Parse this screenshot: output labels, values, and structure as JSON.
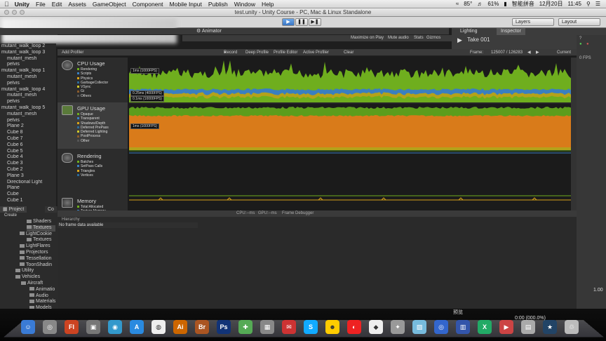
{
  "menubar": {
    "apple": "",
    "items": [
      "Unity",
      "File",
      "Edit",
      "Assets",
      "GameObject",
      "Component",
      "Mobile Input",
      "Publish",
      "Window",
      "Help"
    ],
    "battery": "61%",
    "temp": "85°",
    "ime": "智能拼音",
    "date": "12月20日",
    "time": "11:45"
  },
  "window": {
    "title": "test.unity - Unity Course - PC, Mac & Linux Standalone"
  },
  "toolbar": {
    "layers": "Layers",
    "layout": "Layout"
  },
  "tabs": {
    "animator": "Animator",
    "lighting": "Lighting",
    "inspector": "Inspector"
  },
  "inspector": {
    "take": "Take 001"
  },
  "game_toolbar": {
    "maximize": "Maximize on Play",
    "mute": "Mute audio",
    "stats": "Stats",
    "gizmos": "Gizmos"
  },
  "hierarchy_items": [
    "mutant_walk_loop 2",
    "mutant_walk_loop 3",
    "mutant_mesh",
    "pelvis",
    "mutant_walk_loop 1",
    "mutant_mesh",
    "pelvis",
    "mutant_walk_loop 4",
    "mutant_mesh",
    "pelvis",
    "mutant_walk_loop 5",
    "mutant_mesh",
    "pelvis",
    "Plane 2",
    "Cube 8",
    "Cube 7",
    "Cube 6",
    "Cube 5",
    "Cube 4",
    "Cube 3",
    "Cube 2",
    "Plane 3",
    "Directional Light",
    "Plane",
    "Cube",
    "Cube 1"
  ],
  "profiler": {
    "add_profiler": "Add Profiler",
    "record": "Record",
    "deep_profile": "Deep Profile",
    "profile_editor": "Profile Editor",
    "active_profiler": "Active Profiler",
    "clear": "Clear",
    "frame_label": "Frame:",
    "frame_value": "125007 / 126283",
    "current": "Current",
    "areas": [
      {
        "title": "CPU Usage",
        "legend": [
          "Rendering",
          "Scripts",
          "Physics",
          "GarbageCollector",
          "VSync",
          "Gi",
          "Others"
        ]
      },
      {
        "title": "GPU Usage",
        "legend": [
          "Opaque",
          "Transparent",
          "Shadows/Depth",
          "Deferred PrePass",
          "Deferred Lighting",
          "PostProcess",
          "Other"
        ]
      },
      {
        "title": "Rendering",
        "legend": [
          "Batches",
          "SetPass Calls",
          "Triangles",
          "Vertices"
        ]
      },
      {
        "title": "Memory",
        "legend": [
          "Total Allocated",
          "Texture Memory"
        ]
      }
    ],
    "cpu_labels": [
      "1ms (1000FPS)",
      "0.25ms (4000FPS)",
      "0.1ms (10000FPS)"
    ],
    "gpu_label": "1ms (1000FPS)",
    "cpu_ms": "CPU:--ms",
    "gpu_ms": "GPU:--ms",
    "frame_debugger": "Frame Debugger",
    "hierarchy": "Hierarchy",
    "no_frame": "No frame data available"
  },
  "project": {
    "tab": "Project",
    "tab2": "Co",
    "create": "Create",
    "items": [
      "Shaders",
      "Textures",
      "LightCookie",
      "Textures",
      "LightFlares",
      "Projectors",
      "Tessellation",
      "ToonShadin",
      "Utility",
      "Vehicles",
      "Aircraft",
      "Animatio",
      "Audio",
      "Materials",
      "Models",
      "Prefabs"
    ]
  },
  "right_values": [
    "0 FPS",
    "1.00"
  ],
  "preview": "预览",
  "counter": "0:00 (000.0%)",
  "colors": {
    "cpu_green": "#6fae1e",
    "cpu_blue": "#3a7fc0",
    "gpu_orange": "#d97b1a",
    "gpu_green": "#5c9d1c"
  },
  "dock_icons": [
    "finder-icon",
    "launchpad-icon",
    "flash-icon",
    "photos-icon",
    "qq-icon",
    "appstore-icon",
    "chrome-icon",
    "illustrator-icon",
    "bridge-icon",
    "photoshop-icon",
    "xcode-icon",
    "toolbox-icon",
    "qq-game-icon",
    "skype-icon",
    "weibo-icon",
    "netease-icon",
    "unity-icon",
    "utility-icon",
    "preview-icon",
    "safari-icon",
    "virtualbox-icon",
    "excel-icon",
    "flag-icon",
    "photo-icon",
    "imovie-icon",
    "trash-icon"
  ]
}
